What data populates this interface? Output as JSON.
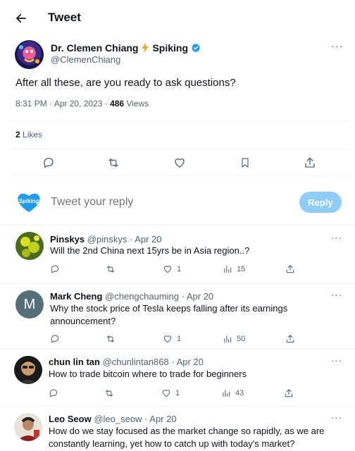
{
  "header": {
    "title": "Tweet"
  },
  "tweet": {
    "author_name": "Dr. Clemen Chiang",
    "author_suffix": "Spiking",
    "author_handle": "@ClemenChiang",
    "text": "After all these, are you ready to ask questions?",
    "time": "8:31 PM · Apr 20, 2023 · ",
    "views_count": "486",
    "views_label": " Views",
    "likes_count": "2",
    "likes_label": " Likes",
    "more": "···"
  },
  "composer": {
    "avatar_text": "Spiking",
    "placeholder": "Tweet your reply",
    "button": "Reply"
  },
  "replies": [
    {
      "name": "Pinskys",
      "handle": "@pinskys · Apr 20",
      "text": "Will the 2nd China next 15yrs be in Asia region..?",
      "likes": "1",
      "views": "15"
    },
    {
      "name": "Mark Cheng",
      "handle": "@chengchauming · Apr 20",
      "text": "Why the stock price of Tesla keeps falling after its earnings announcement?",
      "likes": "1",
      "views": "50",
      "initial": "M"
    },
    {
      "name": "chun lin tan",
      "handle": "@chunlintan868 · Apr 20",
      "text": "How to trade bitcoin where to trade for beginners",
      "likes": "1",
      "views": "43"
    },
    {
      "name": "Leo Seow",
      "handle": "@leo_seow · Apr 20",
      "text": "How do we stay focused as the market change so rapidly, as we are constantly learning, yet how to catch up with today's market?"
    }
  ],
  "colors": {
    "accent": "#1d9bf0",
    "reply_button": "#8ecdf8",
    "muted": "#536471"
  }
}
